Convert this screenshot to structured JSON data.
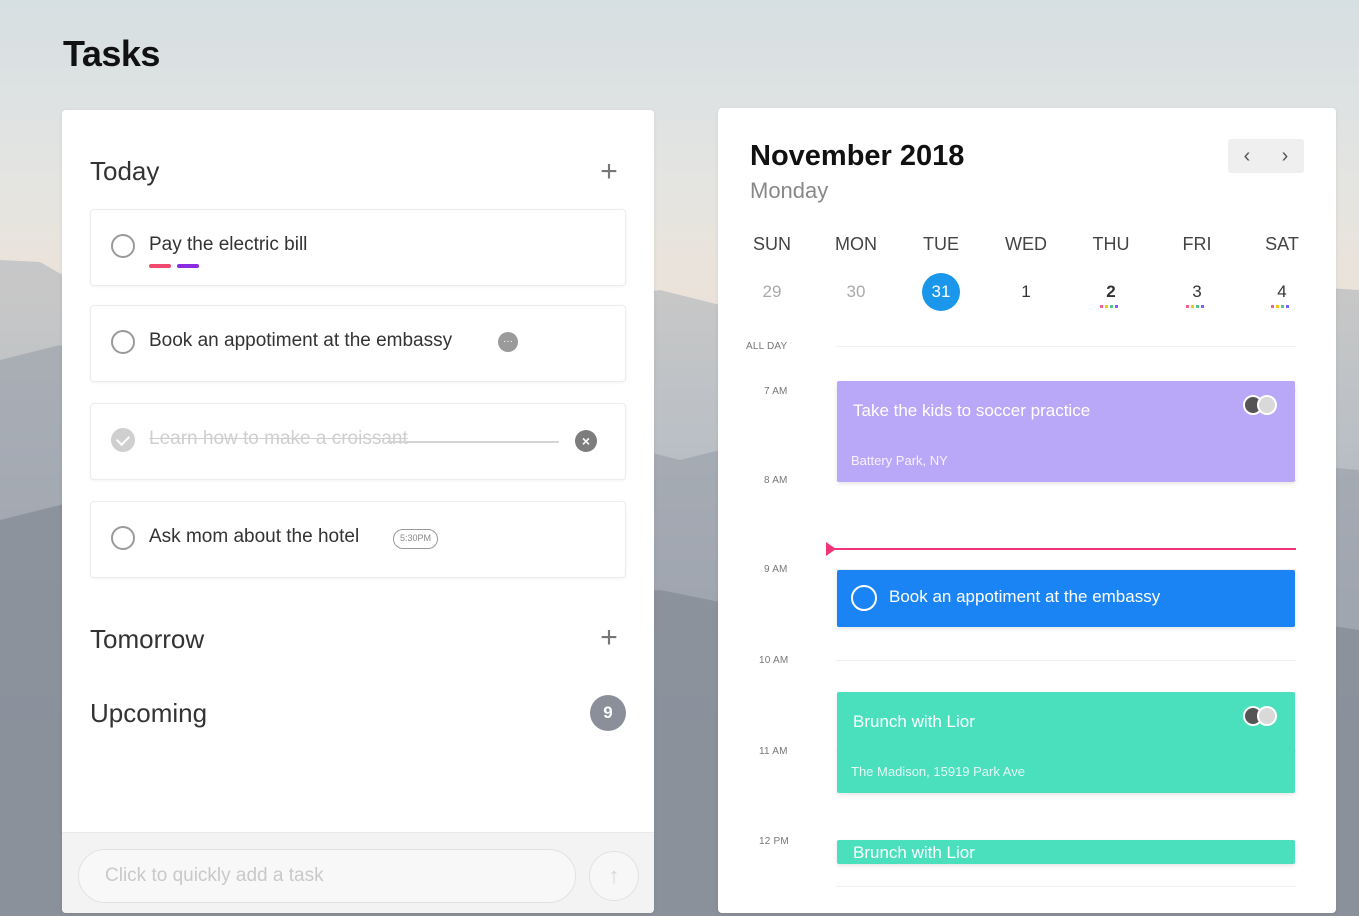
{
  "app": {
    "title": "Tasks"
  },
  "tasks": {
    "sections": {
      "today": "Today",
      "tomorrow": "Tomorrow",
      "upcoming": "Upcoming",
      "upcoming_count": "9"
    },
    "plus_symbol": "+",
    "items": [
      {
        "label": "Pay the electric bill",
        "done": false,
        "tags": [
          "#f04a6e",
          "#8b2be2"
        ]
      },
      {
        "label": "Book an appotiment at the embassy",
        "done": false,
        "note_icon": "note-icon"
      },
      {
        "label": "Learn how to make a croissant",
        "done": true,
        "remove_icon": "×"
      },
      {
        "label": "Ask mom about the hotel",
        "done": false,
        "time": "5:30PM"
      }
    ],
    "quick_add": {
      "placeholder": "Click to quickly add a task",
      "submit_symbol": "↑"
    }
  },
  "calendar": {
    "month_title": "November 2018",
    "day_label": "Monday",
    "nav": {
      "prev": "‹",
      "next": "›"
    },
    "weekdays": [
      "SUN",
      "MON",
      "TUE",
      "WED",
      "THU",
      "FRI",
      "SAT"
    ],
    "dates": [
      "29",
      "30",
      "31",
      "1",
      "2",
      "3",
      "4"
    ],
    "today_index": 2,
    "all_day_label": "ALL DAY",
    "hours": [
      "7 AM",
      "8 AM",
      "9 AM",
      "10 AM",
      "11 AM",
      "12 PM"
    ],
    "events": [
      {
        "title": "Take the kids to soccer practice",
        "location": "Battery Park, NY",
        "color": "#b9a8f7"
      },
      {
        "title": "Book an appotiment at the embassy",
        "color": "#1a84f5"
      },
      {
        "title": "Brunch with Lior",
        "location": "The Madison, 15919 Park Ave",
        "color": "#4ae0be"
      },
      {
        "title": "Brunch with Lior",
        "color": "#4ae0be"
      }
    ],
    "now_line_color": "#f0347a",
    "today_color": "#1a96ea"
  }
}
